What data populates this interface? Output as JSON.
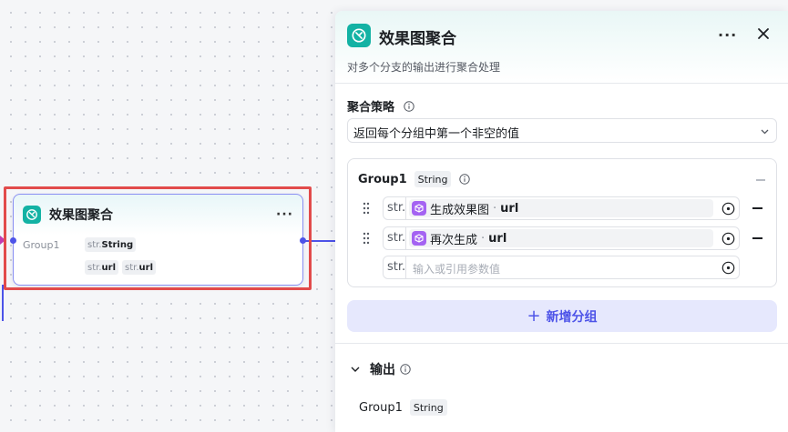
{
  "node": {
    "title": "效果图聚合",
    "more": "···",
    "input_label": "Group1",
    "tags": [
      {
        "prefix": "str.",
        "name": "String"
      },
      {
        "prefix": "str.",
        "name": "url"
      },
      {
        "prefix": "str.",
        "name": "url"
      }
    ]
  },
  "panel": {
    "title": "效果图聚合",
    "description": "对多个分支的输出进行聚合处理",
    "more": "···",
    "strategy": {
      "label": "聚合策略",
      "value": "返回每个分组中第一个非空的值"
    },
    "group": {
      "name": "Group1",
      "type": "String",
      "vars": [
        {
          "prefix": "str.",
          "source": "生成效果图",
          "sep": "·",
          "attr": "url"
        },
        {
          "prefix": "str.",
          "source": "再次生成",
          "sep": "·",
          "attr": "url"
        }
      ],
      "empty_prefix": "str.",
      "placeholder": "输入或引用参数值"
    },
    "add_group": "新增分组",
    "output": {
      "label": "输出",
      "name": "Group1",
      "type": "String"
    }
  },
  "colors": {
    "accent": "#4d53e8",
    "node_icon": "#13b2a4",
    "ref_icon": "#a463f2",
    "highlight": "#e24b4b"
  }
}
